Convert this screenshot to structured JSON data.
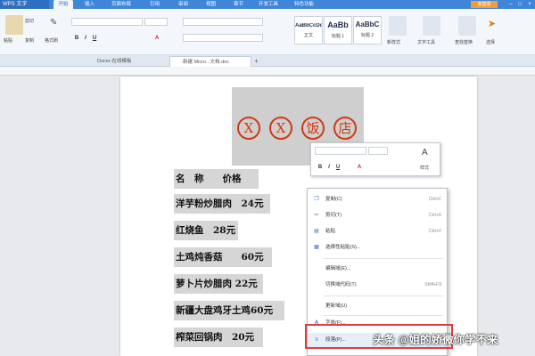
{
  "app": {
    "title": "WPS 文字"
  },
  "menu_tabs": [
    "开始",
    "插入",
    "页面布局",
    "引用",
    "审阅",
    "视图",
    "章节",
    "开发工具",
    "特色功能"
  ],
  "login_label": "未登录",
  "ribbon": {
    "paste": "粘贴",
    "cut": "剪切",
    "copy": "复制",
    "format_painter": "格式刷",
    "styles": [
      {
        "preview": "AaBbCcDd",
        "name": "正文"
      },
      {
        "preview": "AaBb",
        "name": "标题 1"
      },
      {
        "preview": "AaBbC",
        "name": "标题 2"
      }
    ],
    "new_style": "新样式",
    "text_tools": "文字工具",
    "find_replace": "查找替换",
    "select": "选择"
  },
  "doc_tabs": [
    "Docer-在线模板",
    "新建 Micro...文档.doc"
  ],
  "document": {
    "title_chars": [
      "X",
      "X",
      "饭",
      "店"
    ],
    "header": "名　称　　价格",
    "items": [
      "洋芋粉炒腊肉　24元",
      "红烧鱼　28元",
      "土鸡炖香菇　　60元",
      "萝卜片炒腊肉 22元",
      "新疆大盘鸡牙土鸡60元",
      "榨菜回锅肉　20元"
    ]
  },
  "mini_toolbar": {
    "style_label": "样式"
  },
  "context_menu": {
    "items": [
      {
        "icon": "copy-icon",
        "label": "复制(C)",
        "shortcut": "Ctrl+C"
      },
      {
        "icon": "cut-icon",
        "label": "剪切(T)",
        "shortcut": "Ctrl+X"
      },
      {
        "icon": "paste-icon",
        "label": "粘贴",
        "shortcut": "Ctrl+V"
      },
      {
        "icon": "paste-special-icon",
        "label": "选择性粘贴(S)...",
        "shortcut": ""
      },
      {
        "icon": "",
        "label": "编辑域(E)...",
        "shortcut": ""
      },
      {
        "icon": "",
        "label": "切换域代码(T)",
        "shortcut": "Shift+F9"
      },
      {
        "icon": "",
        "label": "更新域(U)",
        "shortcut": ""
      },
      {
        "icon": "font-icon",
        "label": "字体(F)...",
        "shortcut": ""
      },
      {
        "icon": "paragraph-icon",
        "label": "段落(P)...",
        "shortcut": ""
      }
    ]
  },
  "watermark": "头条 @姐的娇微你学不来",
  "colors": {
    "accent": "#3f86d9",
    "highlight_box": "#e23b3b",
    "circle_red": "#d03a12"
  }
}
